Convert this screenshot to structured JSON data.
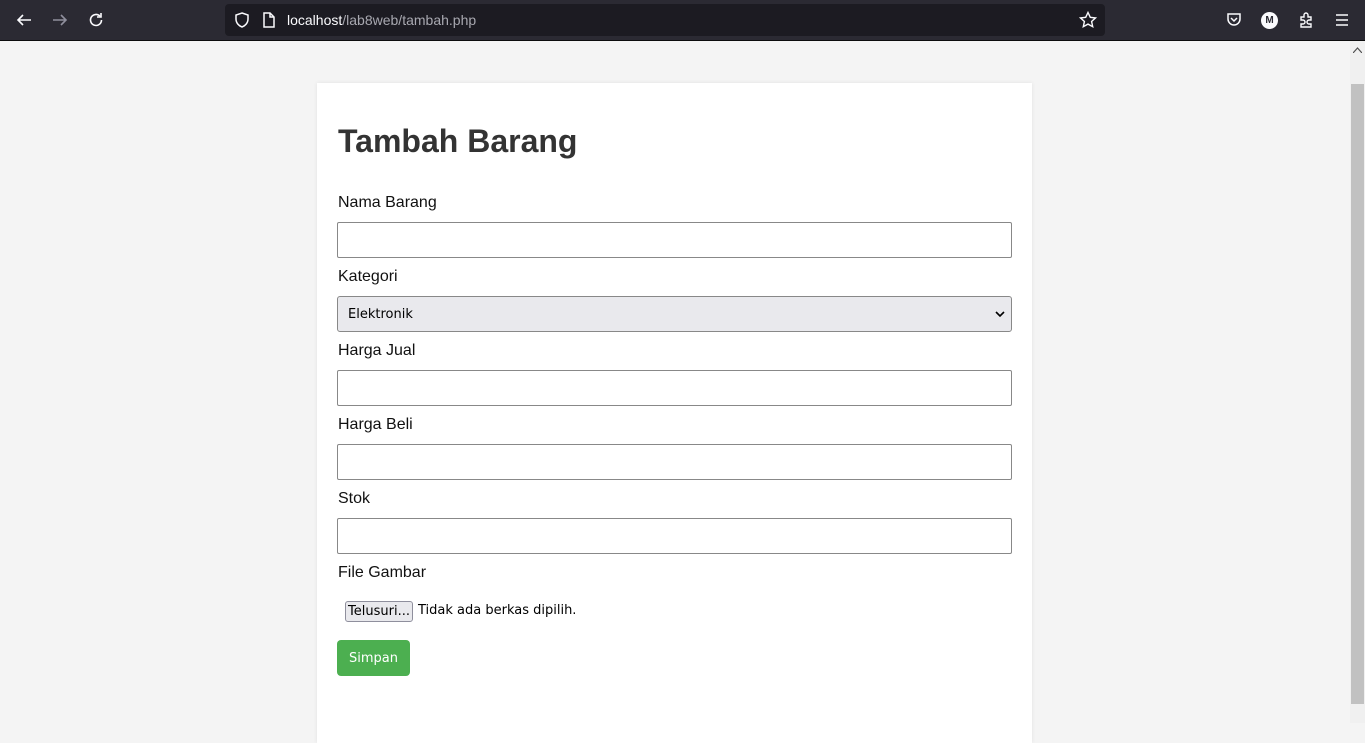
{
  "browser": {
    "url_host": "localhost",
    "url_path": "/lab8web/tambah.php",
    "account_initial": "M",
    "icons": [
      "back-icon",
      "forward-icon",
      "reload-icon",
      "shield-icon",
      "page-icon",
      "bookmark-star-icon",
      "pocket-icon",
      "account-icon",
      "extensions-icon",
      "menu-icon"
    ]
  },
  "form": {
    "title": "Tambah Barang",
    "fields": [
      {
        "label": "Nama Barang",
        "value": ""
      },
      {
        "label": "Kategori",
        "value": "Elektronik"
      },
      {
        "label": "Harga Jual",
        "value": ""
      },
      {
        "label": "Harga Beli",
        "value": ""
      },
      {
        "label": "Stok",
        "value": ""
      },
      {
        "label": "File Gambar"
      }
    ],
    "file_button": "Telusuri...",
    "file_status": "Tidak ada berkas dipilih.",
    "submit_label": "Simpan"
  },
  "colors": {
    "toolbar": "#2b2a33",
    "urlbar": "#1c1b22",
    "page_bg": "#f4f4f4",
    "submit": "#4caf50",
    "title": "#333333"
  }
}
